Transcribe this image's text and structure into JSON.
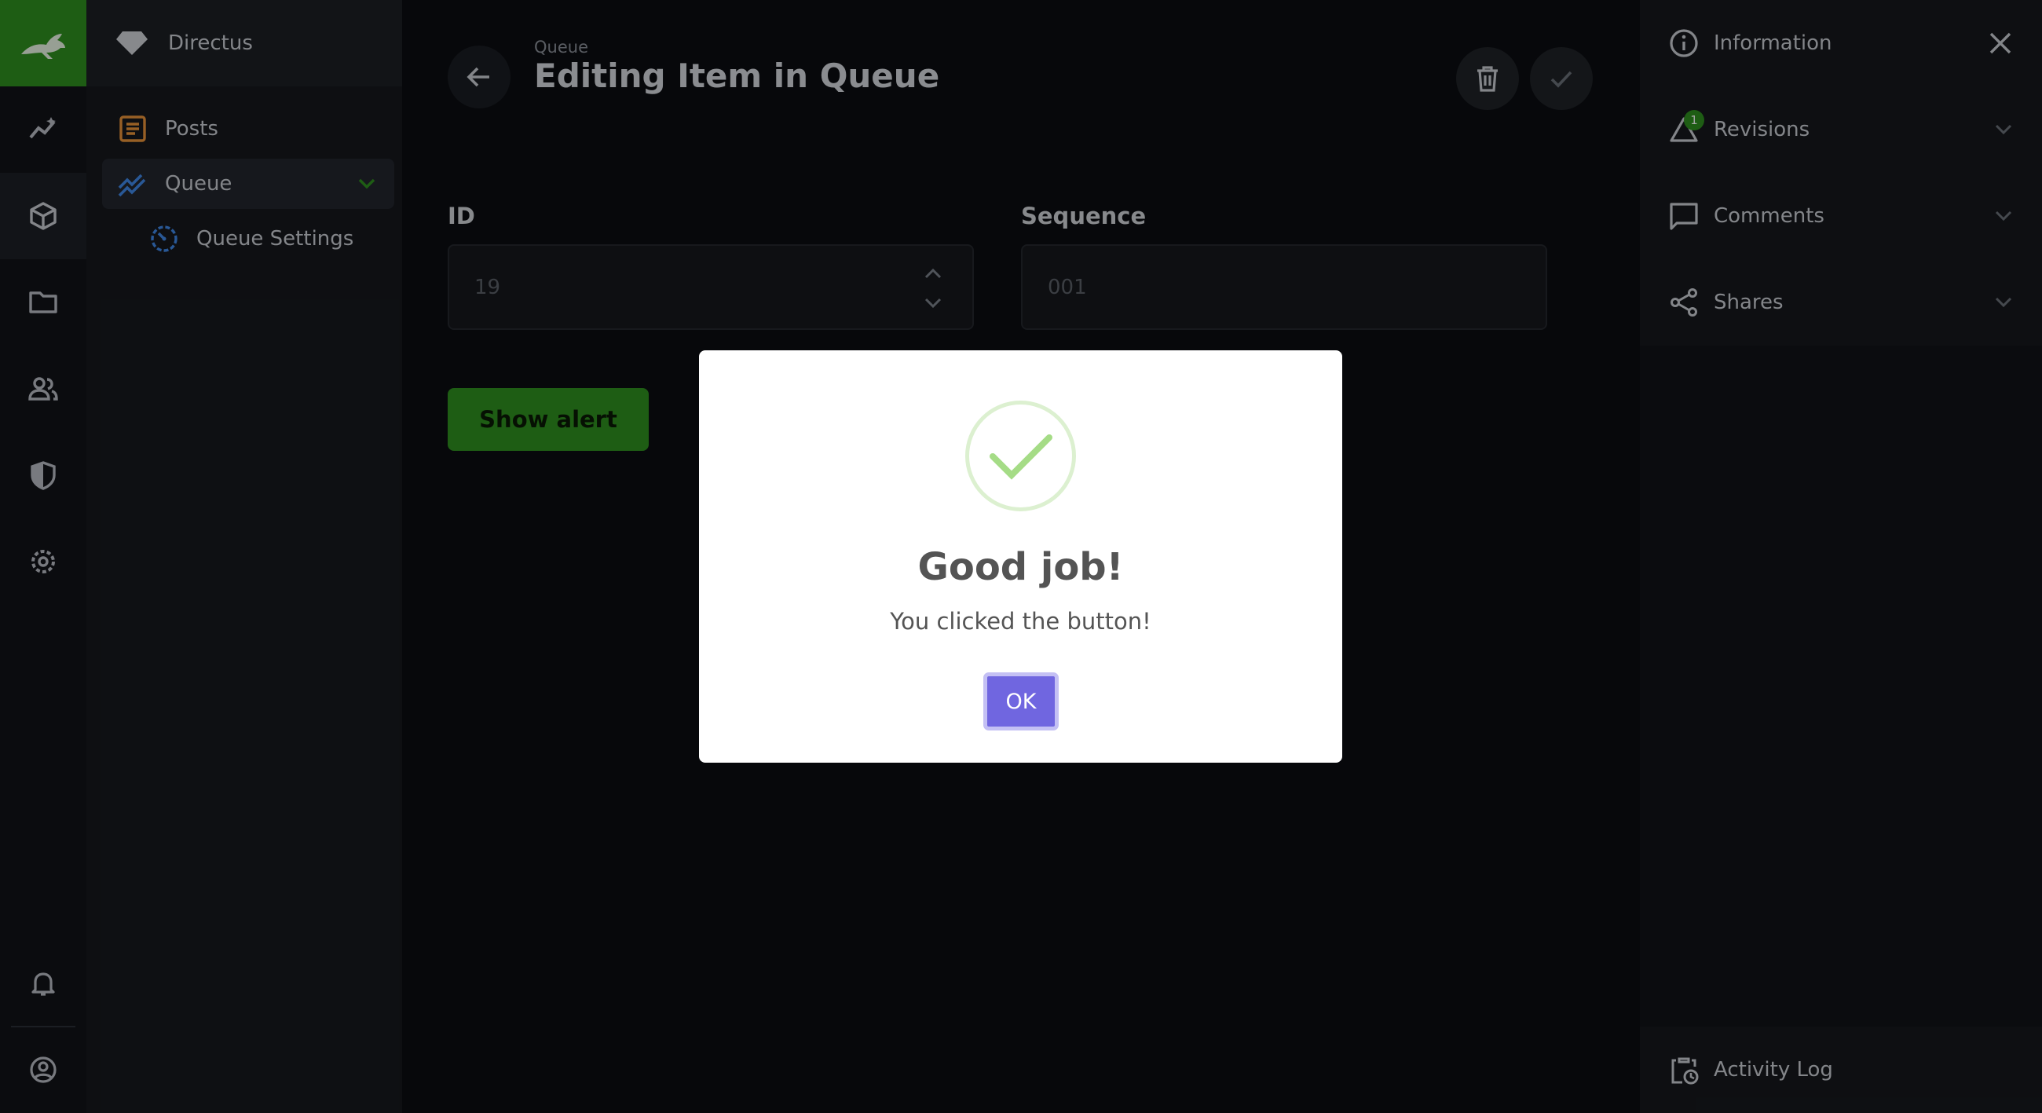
{
  "app": {
    "project_name": "Directus",
    "accent": "#2f8f1f"
  },
  "module_bar": {
    "modules": [
      "insights-icon",
      "content-icon",
      "files-icon",
      "users-icon",
      "access-icon",
      "settings-icon"
    ],
    "bottom": [
      "notifications-icon",
      "profile-icon"
    ]
  },
  "navigation": {
    "items": [
      {
        "label": "Posts",
        "icon": "document-icon"
      },
      {
        "label": "Queue",
        "icon": "trend-icon",
        "expanded": true
      },
      {
        "label": "Queue Settings",
        "icon": "timer-icon"
      }
    ]
  },
  "header": {
    "breadcrumb": "Queue",
    "title": "Editing Item in Queue"
  },
  "form": {
    "id": {
      "label": "ID",
      "value": "19"
    },
    "sequence": {
      "label": "Sequence",
      "value": "001"
    },
    "show_alert_label": "Show alert"
  },
  "sidebar": {
    "items": [
      {
        "label": "Information",
        "icon": "info-icon"
      },
      {
        "label": "Revisions",
        "icon": "revisions-icon",
        "badge": "1"
      },
      {
        "label": "Comments",
        "icon": "comment-icon"
      },
      {
        "label": "Shares",
        "icon": "share-icon"
      }
    ],
    "activity_log": "Activity Log"
  },
  "modal": {
    "title": "Good job!",
    "text": "You clicked the button!",
    "ok_label": "OK",
    "success_color": "#a5dc86",
    "button_color": "#7066e0"
  }
}
